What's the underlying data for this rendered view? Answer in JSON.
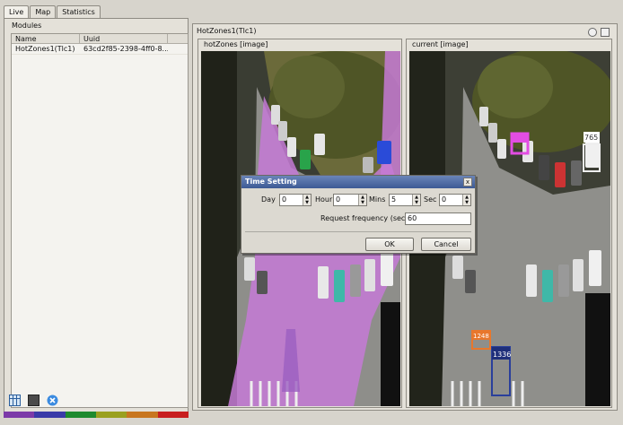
{
  "tabs": [
    "Live",
    "Map",
    "Statistics"
  ],
  "modules": {
    "group_label": "Modules",
    "columns": [
      "Name",
      "Uuid"
    ],
    "rows": [
      {
        "name": "HotZones1(Tlc1)",
        "uuid": "63cd2f85-2398-4ff0-8..."
      }
    ]
  },
  "bottom_icons": [
    "grid-view-icon",
    "stop-icon",
    "close-circle-icon"
  ],
  "color_strip": [
    "#7c3aa8",
    "#3a3aa8",
    "#1e8a2e",
    "#9aa01e",
    "#c8761e",
    "#c81e1e"
  ],
  "viewer": {
    "title": "HotZones1(Tlc1)",
    "hot_label": "hotZones [image]",
    "cur_label": "current [image]",
    "tracked_ids": [
      "765",
      "1248",
      "1336"
    ]
  },
  "dialog": {
    "title": "Time Setting",
    "close": "x",
    "day_label": "Day",
    "day_value": "0",
    "hour_label": "Hour",
    "hour_value": "0",
    "mins_label": "Mins",
    "mins_value": "5",
    "sec_label": "Sec",
    "sec_value": "0",
    "freq_label": "Request frequency (sec)",
    "freq_value": "60",
    "ok": "OK",
    "cancel": "Cancel"
  }
}
